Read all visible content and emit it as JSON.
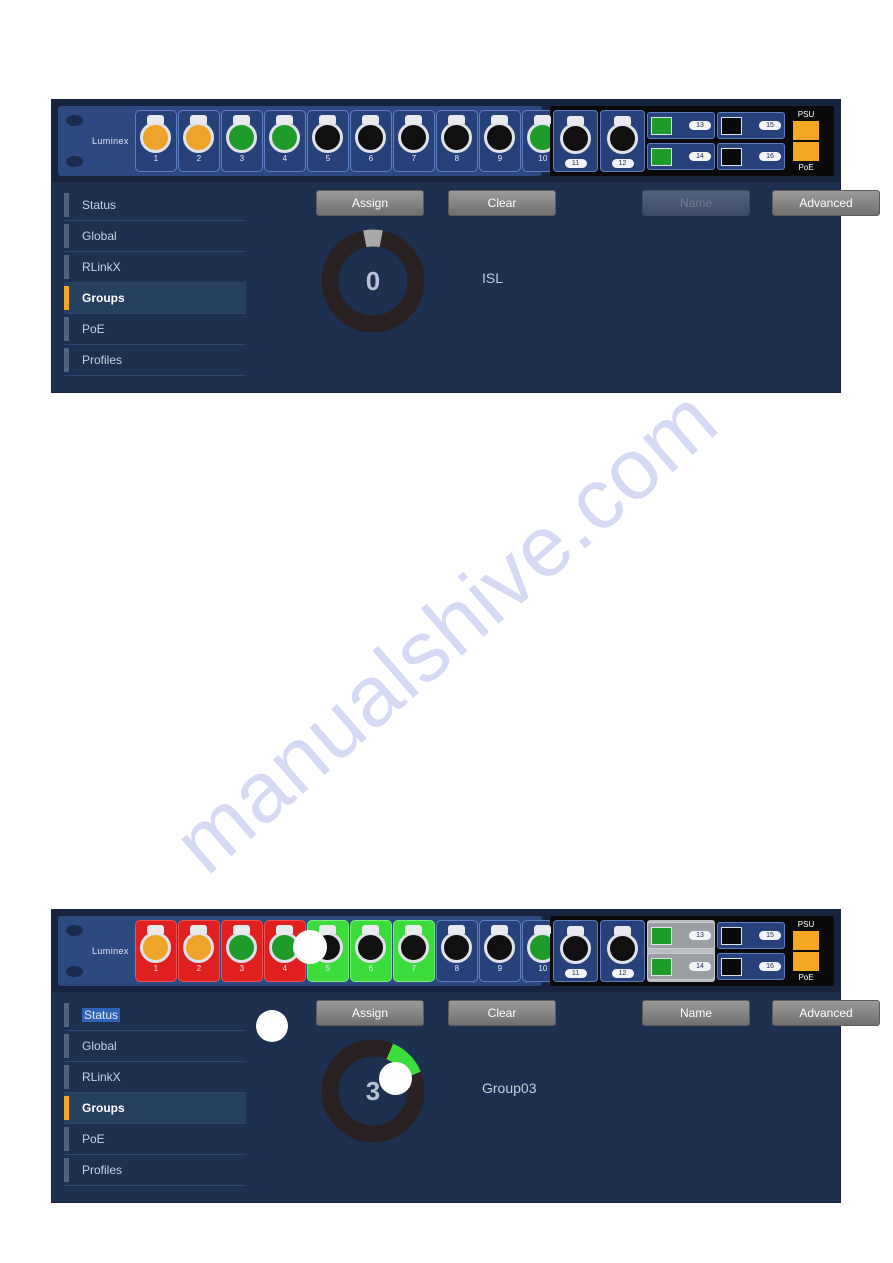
{
  "watermark": {
    "text": "manualshive.com"
  },
  "device": {
    "brand": "Luminex",
    "psu_label": "PSU",
    "poe_label": "PoE"
  },
  "sidebar": {
    "items": [
      {
        "label": "Status"
      },
      {
        "label": "Global"
      },
      {
        "label": "RLinkX"
      },
      {
        "label": "Groups"
      },
      {
        "label": "PoE"
      },
      {
        "label": "Profiles"
      }
    ]
  },
  "toolbar": {
    "assign_label": "Assign",
    "clear_label": "Clear",
    "name_label": "Name",
    "advanced_label": "Advanced"
  },
  "panel_top": {
    "ports": [
      {
        "num": "1",
        "jack": "amber",
        "highlight": "none"
      },
      {
        "num": "2",
        "jack": "amber",
        "highlight": "none"
      },
      {
        "num": "3",
        "jack": "green",
        "highlight": "none"
      },
      {
        "num": "4",
        "jack": "green",
        "highlight": "none"
      },
      {
        "num": "5",
        "jack": "black",
        "highlight": "none"
      },
      {
        "num": "6",
        "jack": "black",
        "highlight": "none"
      },
      {
        "num": "7",
        "jack": "black",
        "highlight": "none"
      },
      {
        "num": "8",
        "jack": "black",
        "highlight": "none"
      },
      {
        "num": "9",
        "jack": "black",
        "highlight": "none"
      },
      {
        "num": "10",
        "jack": "green",
        "highlight": "none"
      }
    ],
    "module_ports": [
      {
        "num": "11",
        "jack": "black"
      },
      {
        "num": "12",
        "jack": "black"
      }
    ],
    "sfp_left": [
      {
        "num": "13",
        "led": "green"
      },
      {
        "num": "14",
        "led": "green"
      }
    ],
    "sfp_right": [
      {
        "num": "15",
        "led": "black"
      },
      {
        "num": "16",
        "led": "black"
      }
    ],
    "sfp_left_highlighted": false,
    "dial_value": "0",
    "dial_arc_degrees": 0,
    "dial_arc_color": "#a8a8a8",
    "group_name": "ISL",
    "name_button_enabled": false,
    "active_nav": "Groups",
    "selected_nav_text": null
  },
  "panel_bottom": {
    "ports": [
      {
        "num": "1",
        "jack": "amber",
        "highlight": "red"
      },
      {
        "num": "2",
        "jack": "amber",
        "highlight": "red"
      },
      {
        "num": "3",
        "jack": "green",
        "highlight": "red"
      },
      {
        "num": "4",
        "jack": "green",
        "highlight": "red"
      },
      {
        "num": "5",
        "jack": "black",
        "highlight": "green"
      },
      {
        "num": "6",
        "jack": "black",
        "highlight": "green"
      },
      {
        "num": "7",
        "jack": "black",
        "highlight": "green"
      },
      {
        "num": "8",
        "jack": "black",
        "highlight": "none"
      },
      {
        "num": "9",
        "jack": "black",
        "highlight": "none"
      },
      {
        "num": "10",
        "jack": "green",
        "highlight": "none"
      }
    ],
    "module_ports": [
      {
        "num": "11",
        "jack": "black"
      },
      {
        "num": "12",
        "jack": "black"
      }
    ],
    "sfp_left": [
      {
        "num": "13",
        "led": "green"
      },
      {
        "num": "14",
        "led": "green"
      }
    ],
    "sfp_right": [
      {
        "num": "15",
        "led": "black"
      },
      {
        "num": "16",
        "led": "black"
      }
    ],
    "sfp_left_highlighted": true,
    "dial_value": "3",
    "dial_arc_degrees": 45,
    "dial_arc_color": "#3ddc3d",
    "group_name": "Group03",
    "name_button_enabled": true,
    "active_nav": "Groups",
    "selected_nav_text": "Status"
  },
  "colors": {
    "panel_bg": "#1d3050",
    "accent_orange": "#f5a623",
    "select_green": "#3ddc3d",
    "select_red": "#e02020",
    "text_selection_blue": "#2f63b5"
  }
}
